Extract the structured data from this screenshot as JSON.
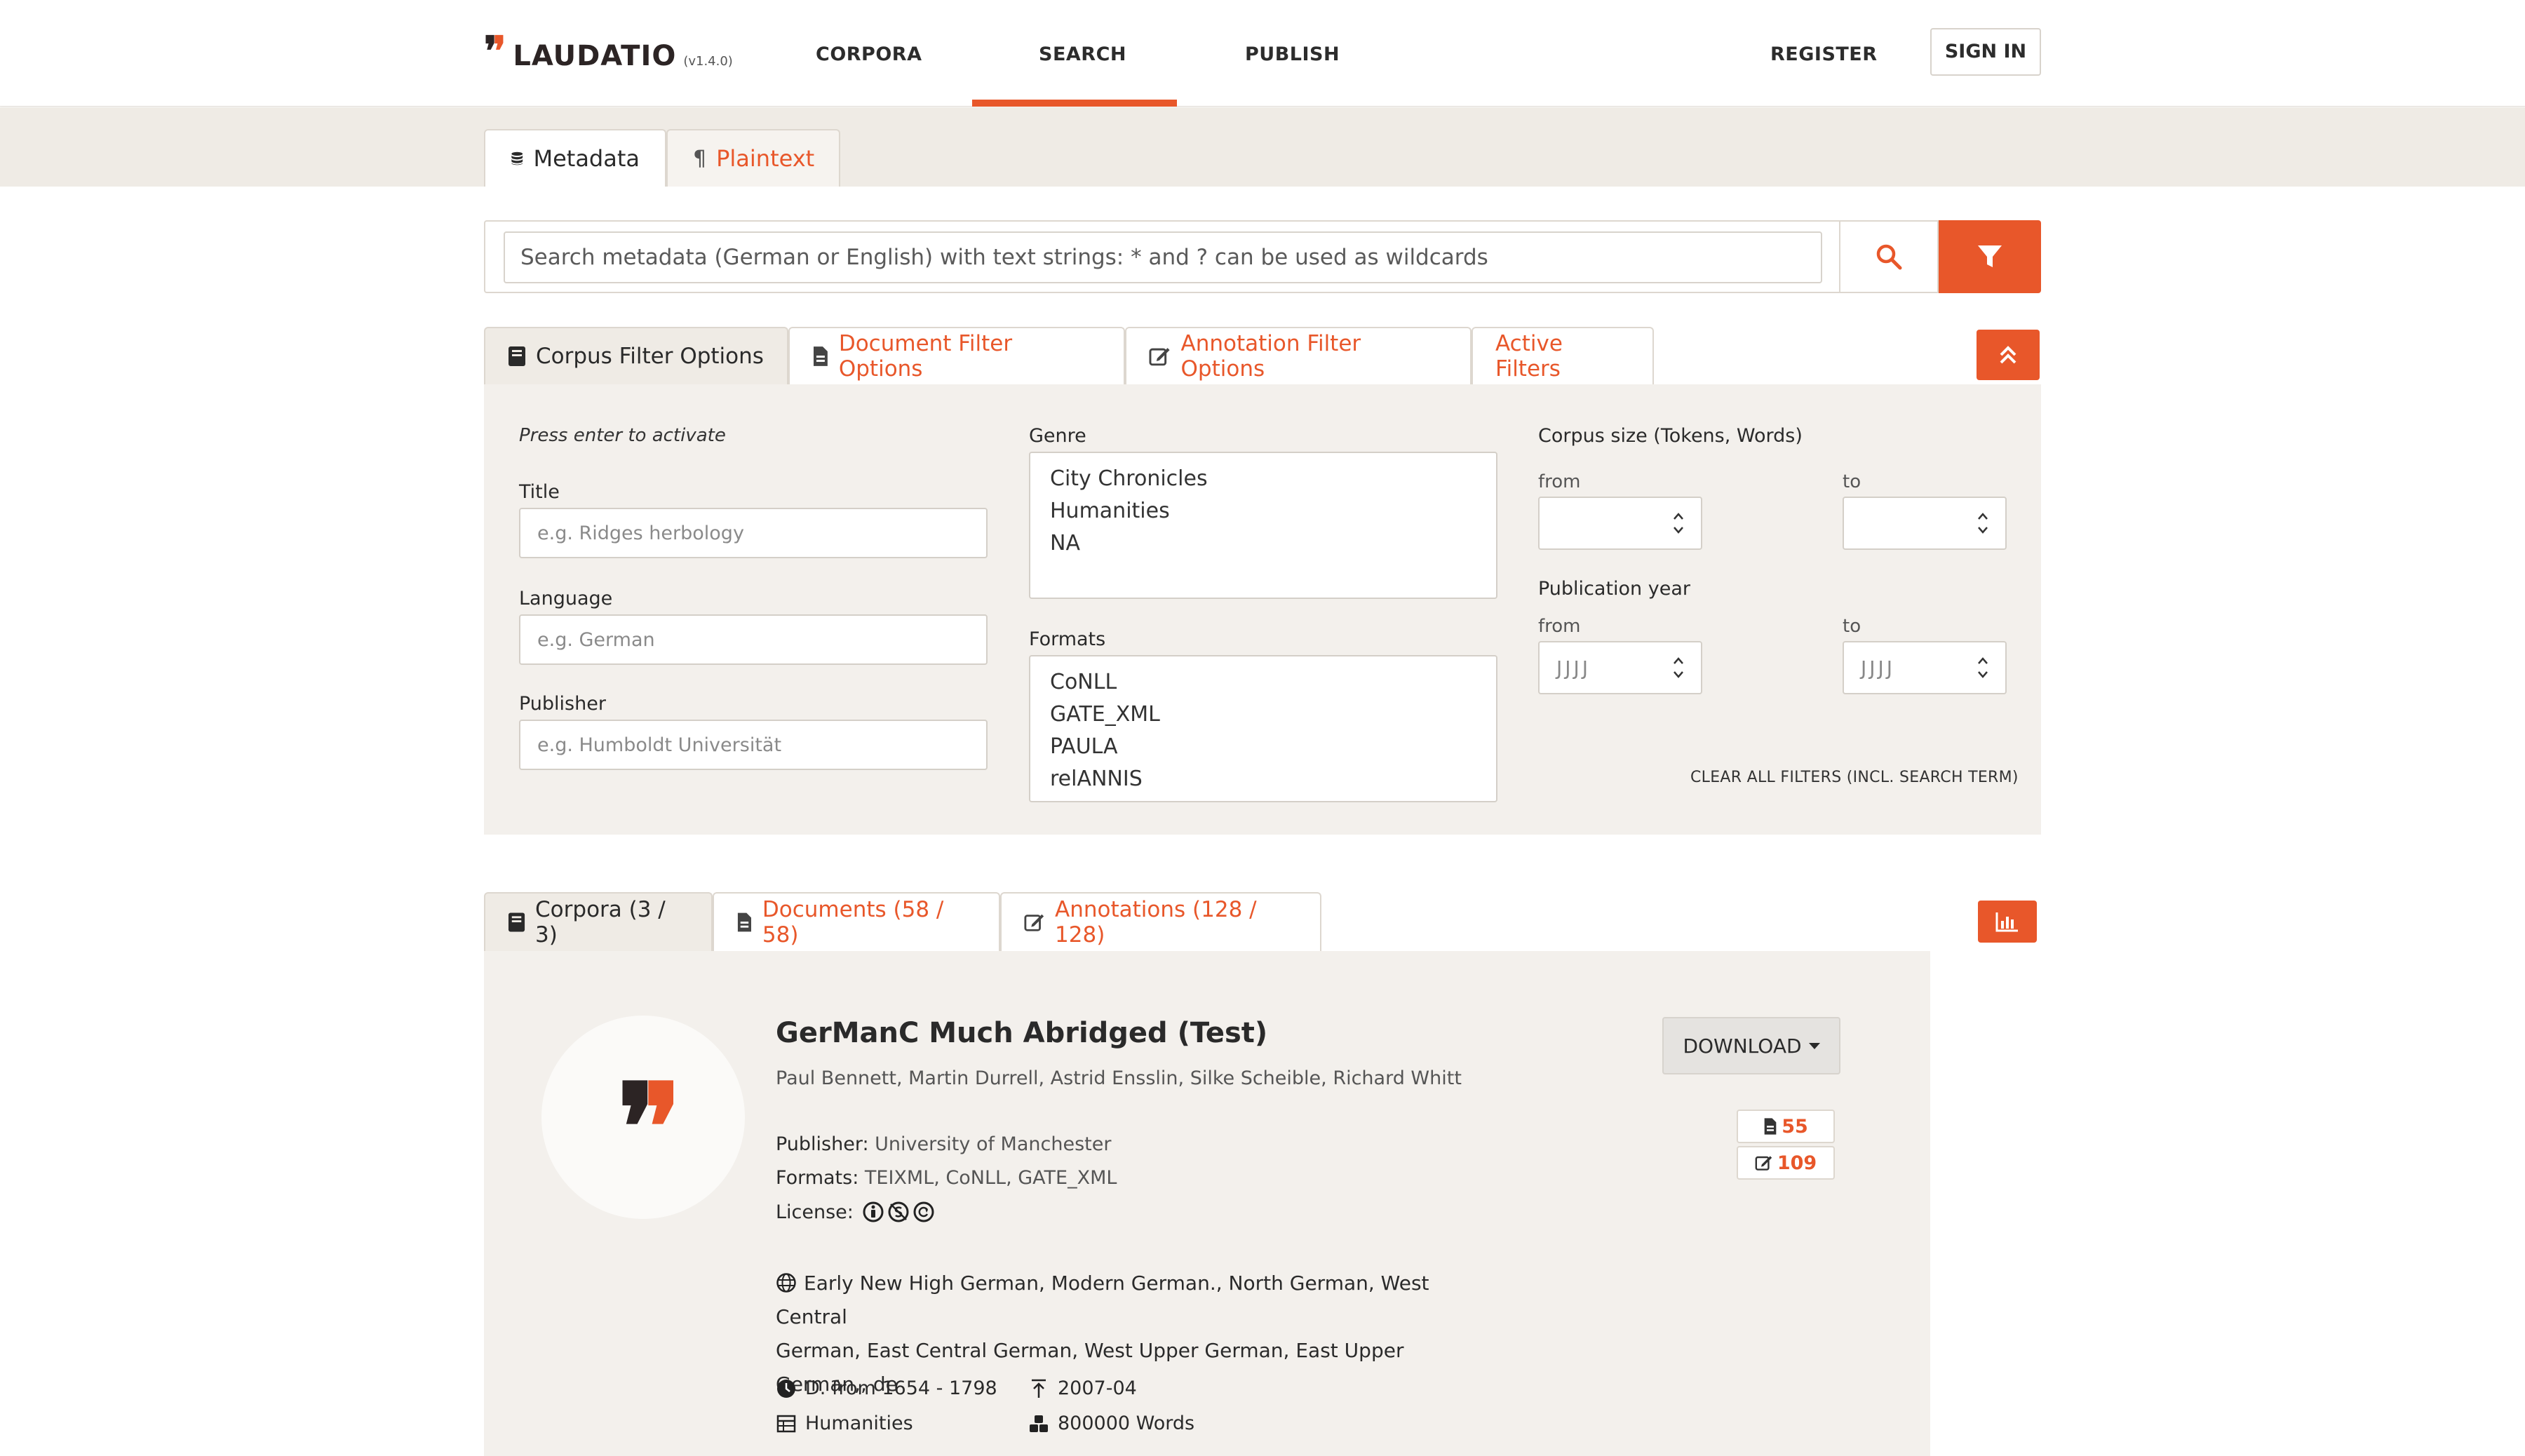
{
  "header": {
    "logo_text": "LAUDATIO",
    "version": "(v1.4.0)",
    "nav": [
      "CORPORA",
      "SEARCH",
      "PUBLISH"
    ],
    "register": "REGISTER",
    "sign_in": "SIGN IN"
  },
  "search_mode": {
    "tabs": [
      "Metadata",
      "Plaintext"
    ],
    "active": "Metadata"
  },
  "search": {
    "placeholder": "Search metadata (German or English) with text strings: * and ? can be used as wildcards"
  },
  "filter_tabs": {
    "items": [
      "Corpus Filter Options",
      "Document Filter Options",
      "Annotation Filter Options",
      "Active Filters"
    ],
    "active": "Corpus Filter Options"
  },
  "filters": {
    "hint": "Press enter to activate",
    "title_label": "Title",
    "title_placeholder": "e.g. Ridges herbology",
    "language_label": "Language",
    "language_placeholder": "e.g. German",
    "publisher_label": "Publisher",
    "publisher_placeholder": "e.g. Humboldt Universität",
    "genre_label": "Genre",
    "genre_options": [
      "City Chronicles",
      "Humanities",
      "NA"
    ],
    "formats_label": "Formats",
    "formats_options": [
      "CoNLL",
      "GATE_XML",
      "PAULA",
      "relANNIS"
    ],
    "corpus_size_label": "Corpus size (Tokens, Words)",
    "from_label": "from",
    "to_label": "to",
    "pub_year_label": "Publication year",
    "year_placeholder": "JJJJ",
    "clear_all": "CLEAR ALL FILTERS (INCL. SEARCH TERM)"
  },
  "result_tabs": {
    "items": [
      "Corpora (3 / 3)",
      "Documents (58 / 58)",
      "Annotations (128 / 128)"
    ],
    "active": "Corpora (3 / 3)"
  },
  "result": {
    "title": "GerManC Much Abridged (Test)",
    "authors": "Paul Bennett, Martin Durrell, Astrid Ensslin, Silke Scheible, Richard Whitt",
    "publisher_label": "Publisher:",
    "publisher": "University of Manchester",
    "formats_label": "Formats:",
    "formats": "TEIXML, CoNLL, GATE_XML",
    "license_label": "License:",
    "languages_line1": "Early New High German, Modern German., North German, West Central",
    "languages_line2": "German, East Central German, West Upper German, East Upper German,, de",
    "date_range": "D. from 1654 - 1798",
    "published": "2007-04",
    "genre": "Humanities",
    "size": "800000 Words",
    "download": "DOWNLOAD",
    "documents_count": "55",
    "annotations_count": "109"
  },
  "colors": {
    "accent": "#e8572a",
    "dark": "#2c2424",
    "panel": "#f3f0ec"
  }
}
